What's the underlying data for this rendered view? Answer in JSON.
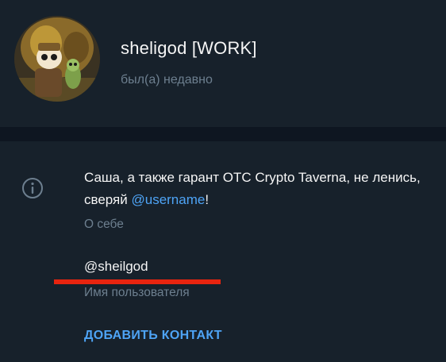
{
  "profile": {
    "name": "sheligod [WORK]",
    "status": "был(а) недавно",
    "avatar_icon": "cartoon-avatar-image"
  },
  "info": {
    "icon": "info-icon",
    "about_text_before": "Саша, а также гарант OTC Crypto Taverna, не ленись, сверяй ",
    "about_link": "@username",
    "about_text_after": "!",
    "about_label": "О себе",
    "username": "@sheilgod",
    "username_label": "Имя пользователя",
    "add_contact_label": "ДОБАВИТЬ КОНТАКТ"
  },
  "colors": {
    "background": "#17212b",
    "divider": "#0e1621",
    "accent": "#4ea4f6",
    "secondary_text": "#6d7f8f",
    "annotation_underline": "#e8240f"
  }
}
